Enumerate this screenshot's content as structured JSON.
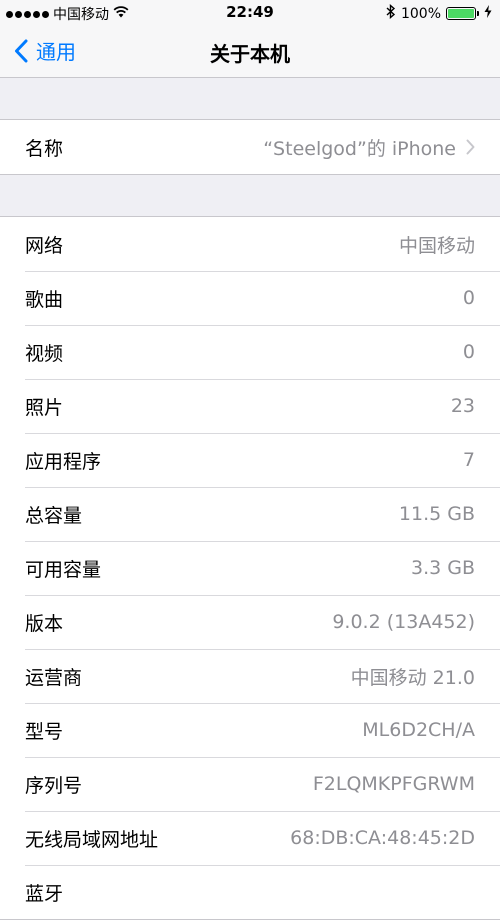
{
  "status_bar": {
    "carrier": "中国移动",
    "time": "22:49",
    "battery_percent": "100%",
    "battery_level": 1.0,
    "battery_color": "#4cd964",
    "icons": [
      "signal-dots-icon",
      "wifi-icon",
      "bluetooth-icon",
      "battery-icon",
      "charging-icon"
    ]
  },
  "nav": {
    "back_label": "通用",
    "title": "关于本机",
    "accent_color": "#007aff"
  },
  "name_row": {
    "label": "名称",
    "value": "“Steelgod”的 iPhone"
  },
  "info_rows": [
    {
      "label": "网络",
      "value": "中国移动"
    },
    {
      "label": "歌曲",
      "value": "0"
    },
    {
      "label": "视频",
      "value": "0"
    },
    {
      "label": "照片",
      "value": "23"
    },
    {
      "label": "应用程序",
      "value": "7"
    },
    {
      "label": "总容量",
      "value": "11.5 GB"
    },
    {
      "label": "可用容量",
      "value": "3.3 GB"
    },
    {
      "label": "版本",
      "value": "9.0.2 (13A452)"
    },
    {
      "label": "运营商",
      "value": "中国移动 21.0"
    },
    {
      "label": "型号",
      "value": "ML6D2CH/A"
    },
    {
      "label": "序列号",
      "value": "F2LQMKPFGRWM"
    },
    {
      "label": "无线局域网地址",
      "value": "68:DB:CA:48:45:2D"
    },
    {
      "label": "蓝牙",
      "value": ""
    }
  ]
}
